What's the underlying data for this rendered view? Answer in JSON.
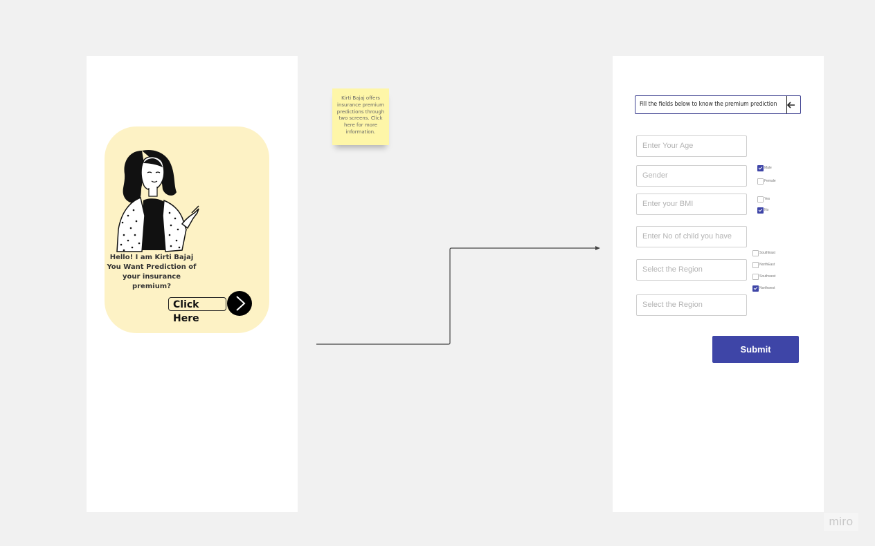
{
  "welcome_screen": {
    "greeting_lines": [
      "Hello! I am Kirti Bajaj",
      "You Want Prediction of",
      "your insurance premium?"
    ],
    "cta_label": "Click Here",
    "illustration": "woman-pointing-illustration",
    "arrow_icon": "chevron-right-icon"
  },
  "sticky_note": {
    "text": "Kirti Bajaj offers insurance premium predictions through two screens. Click here for more information."
  },
  "form_screen": {
    "title": "Fill the fields below to know the premium prediction",
    "back_icon": "arrow-left-icon",
    "fields": {
      "age_placeholder": "Enter Your Age",
      "gender_placeholder": "Gender",
      "bmi_placeholder": "Enter your BMI",
      "children_placeholder": "Enter No of child you have",
      "region_placeholder": "Select the Region",
      "region2_placeholder": "Select the Region"
    },
    "gender_options": [
      {
        "label": "Male",
        "checked": true
      },
      {
        "label": "Female",
        "checked": false
      }
    ],
    "smoker_options": [
      {
        "label": "Yes",
        "checked": false
      },
      {
        "label": "No",
        "checked": true
      }
    ],
    "region_options": [
      {
        "label": "SouthEast",
        "checked": false
      },
      {
        "label": "NorthEast",
        "checked": false
      },
      {
        "label": "Southwest",
        "checked": false
      },
      {
        "label": "Northwest",
        "checked": true
      }
    ],
    "submit_label": "Submit"
  },
  "branding": {
    "logo_text": "miro"
  },
  "colors": {
    "canvas": "#f1f1f1",
    "card": "#fdf2c5",
    "sticky": "#fef6a8",
    "accent": "#3e45a7"
  }
}
